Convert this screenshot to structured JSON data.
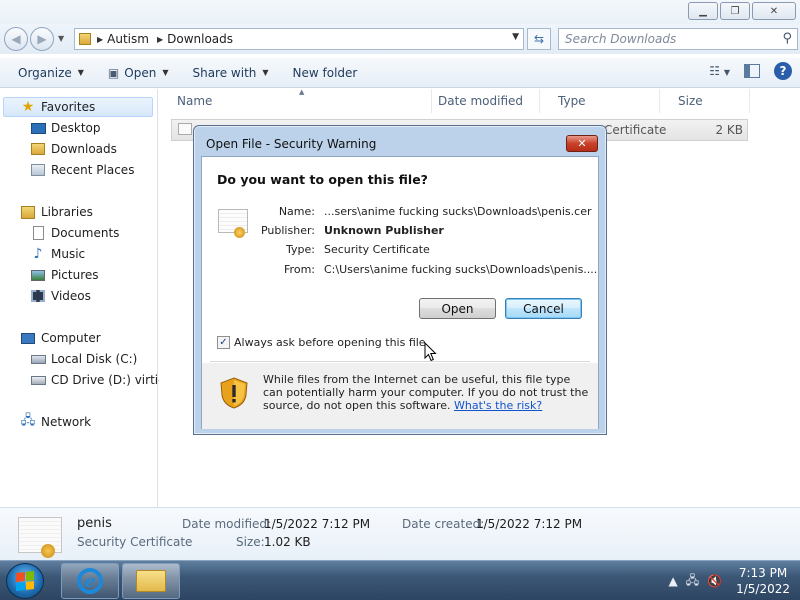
{
  "explorer": {
    "breadcrumb": [
      "Autism",
      "Downloads"
    ],
    "search_placeholder": "Search Downloads",
    "toolbar": {
      "organize": "Organize",
      "open": "Open",
      "share_with": "Share with",
      "new_folder": "New folder"
    },
    "nav": {
      "favorites": "Favorites",
      "desktop": "Desktop",
      "downloads": "Downloads",
      "recent_places": "Recent Places",
      "libraries": "Libraries",
      "documents": "Documents",
      "music": "Music",
      "pictures": "Pictures",
      "videos": "Videos",
      "computer": "Computer",
      "local_disk": "Local Disk (C:)",
      "cd_drive": "CD Drive (D:) virtio-v",
      "network": "Network"
    },
    "columns": {
      "name": "Name",
      "date_modified": "Date modified",
      "type": "Type",
      "size": "Size"
    },
    "file": {
      "type_visible": "Certificate",
      "size": "2 KB"
    },
    "details": {
      "name": "penis",
      "type": "Security Certificate",
      "date_modified_label": "Date modified:",
      "date_modified_value": "1/5/2022 7:12 PM",
      "date_created_label": "Date created:",
      "date_created_value": "1/5/2022 7:12 PM",
      "size_label": "Size:",
      "size_value": "1.02 KB"
    }
  },
  "dialog": {
    "title": "Open File - Security Warning",
    "question": "Do you want to open this file?",
    "name_label": "Name:",
    "name_value": "...sers\\anime fucking sucks\\Downloads\\penis.cer",
    "publisher_label": "Publisher:",
    "publisher_value": "Unknown Publisher",
    "type_label": "Type:",
    "type_value": "Security Certificate",
    "from_label": "From:",
    "from_value": "C:\\Users\\anime fucking sucks\\Downloads\\penis....",
    "open_button": "Open",
    "cancel_button": "Cancel",
    "checkbox_label": "Always ask before opening this file",
    "checkbox_checked": true,
    "warning_text": "While files from the Internet can be useful, this file type can potentially harm your computer. If you do not trust the source, do not open this software.",
    "risk_link": "What's the risk?"
  },
  "taskbar": {
    "time": "7:13 PM",
    "date": "1/5/2022"
  },
  "colors": {
    "dialog_frame": "#bcd1ea",
    "close_red": "#c9412a",
    "link_blue": "#1155cc",
    "taskbar": "#3c5776"
  }
}
